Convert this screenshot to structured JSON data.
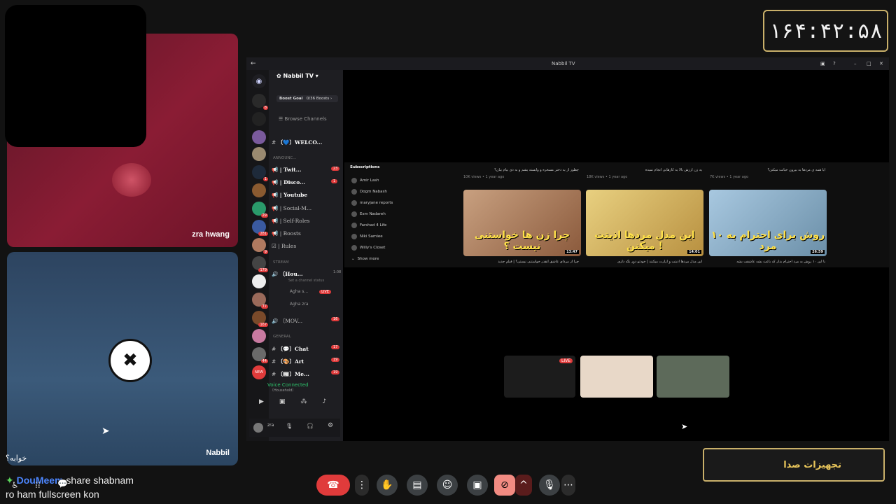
{
  "timer": {
    "value": "۱۶۴:۴۲:۵۸"
  },
  "sound_overlay": {
    "label": "تجهیزات صدا"
  },
  "tiles": [
    {
      "name": "zra hwang"
    },
    {
      "name": "Nabbil"
    }
  ],
  "overlay_text": {
    "khabeh": "خوابه؟"
  },
  "chat": {
    "user": "DouMeem",
    "line1": "share shabnam",
    "line2": "ro ham fullscreen kon"
  },
  "discord": {
    "window_title": "Nabbil TV",
    "guild_name": "Nabbil TV",
    "boost_goal": "Boost Goal",
    "boost_count": "0/36 Boosts",
    "browse": "Browse Channels",
    "categories": [
      "ANNOUNC...",
      "STREAM",
      "GENERAL"
    ],
    "channels": [
      {
        "label": "〔💙〕WELCO...",
        "count": ""
      },
      {
        "label": "| Twit...",
        "count": "23"
      },
      {
        "label": "| Disco...",
        "count": "1"
      },
      {
        "label": "| Youtube",
        "count": ""
      },
      {
        "label": "| Social-M...",
        "count": ""
      },
      {
        "label": "| Self-Roles",
        "count": ""
      },
      {
        "label": "| Boosts",
        "count": ""
      },
      {
        "label": "| Rules",
        "count": ""
      },
      {
        "label": "〔Hou...",
        "count": "1:08"
      },
      {
        "label": "〔MOV...",
        "count": "16"
      },
      {
        "label": "〔💬〕Chat",
        "count": "17"
      },
      {
        "label": "〔🎨〕Art",
        "count": "19"
      },
      {
        "label": "〔📰〕Me...",
        "count": "19"
      }
    ],
    "status_line": "Set a channel status",
    "voice_users": [
      "Agha s...",
      "Agha zra"
    ],
    "live_badge": "LIVE",
    "new_badge": "NEW",
    "voice_connected": "Voice Connected",
    "voice_channel": "〔Household〕",
    "username": "zra",
    "server_badges": [
      "8",
      "1",
      "29",
      "281",
      "9",
      "179",
      "77",
      "167",
      "44"
    ]
  },
  "youtube": {
    "subscriptions_label": "Subscriptions",
    "subscriptions": [
      "Amir Lash",
      "Dogm Nabash",
      "maryjane reports",
      "Esm Nadareh",
      "Farshad 4 Life",
      "Niki Samiee",
      "Willy's Closet"
    ],
    "show_more": "Show more",
    "top_titles": [
      "چطور از یه دختر مسخره و وابسته یشم و به دی بیام بیان؟",
      "یه زن ارزش بالا یه کارهایی انجام نمیده",
      "آیا همه ی مردها به بیرون خیانت میکنن؟"
    ],
    "top_meta": [
      "10K views • 1 year ago",
      "18K views • 1 year ago",
      "7K views • 1 year ago"
    ],
    "videos": [
      {
        "thumb_text": "چرا زن ها خواستنی نیست ؟",
        "duration": "13:47",
        "title": "چرا از مردای عاشق آنقدر خواستنی نیستن؟ | فیلم جدید",
        "color": "#8b5a3c"
      },
      {
        "thumb_text": "این مدل مردها اذیتت میکنن !",
        "duration": "14:01",
        "title": "این مدل مردها اذیتت و آزارت میکنند | خودتو دور نگه داری",
        "color": "#b89040"
      },
      {
        "thumb_text": "۱۰ روش برای احترام به مرد",
        "duration": "26:59",
        "title": "با این ۱۰ روش به مرد احترام بذار که باعث بشه عاشقت بشه",
        "color": "#6b8fa8"
      }
    ]
  },
  "participants": [
    {
      "name": "screen-share",
      "badge": "LIVE",
      "color": "#222"
    },
    {
      "name": "cat-tile-1",
      "color": "#e8d8c8"
    },
    {
      "name": "cat-tile-2",
      "color": "#5d6a5a"
    }
  ],
  "controls": [
    "end-call",
    "more",
    "raise-hand",
    "captions",
    "emoji",
    "present",
    "camera-off",
    "camera-options",
    "mic",
    "more-options"
  ]
}
